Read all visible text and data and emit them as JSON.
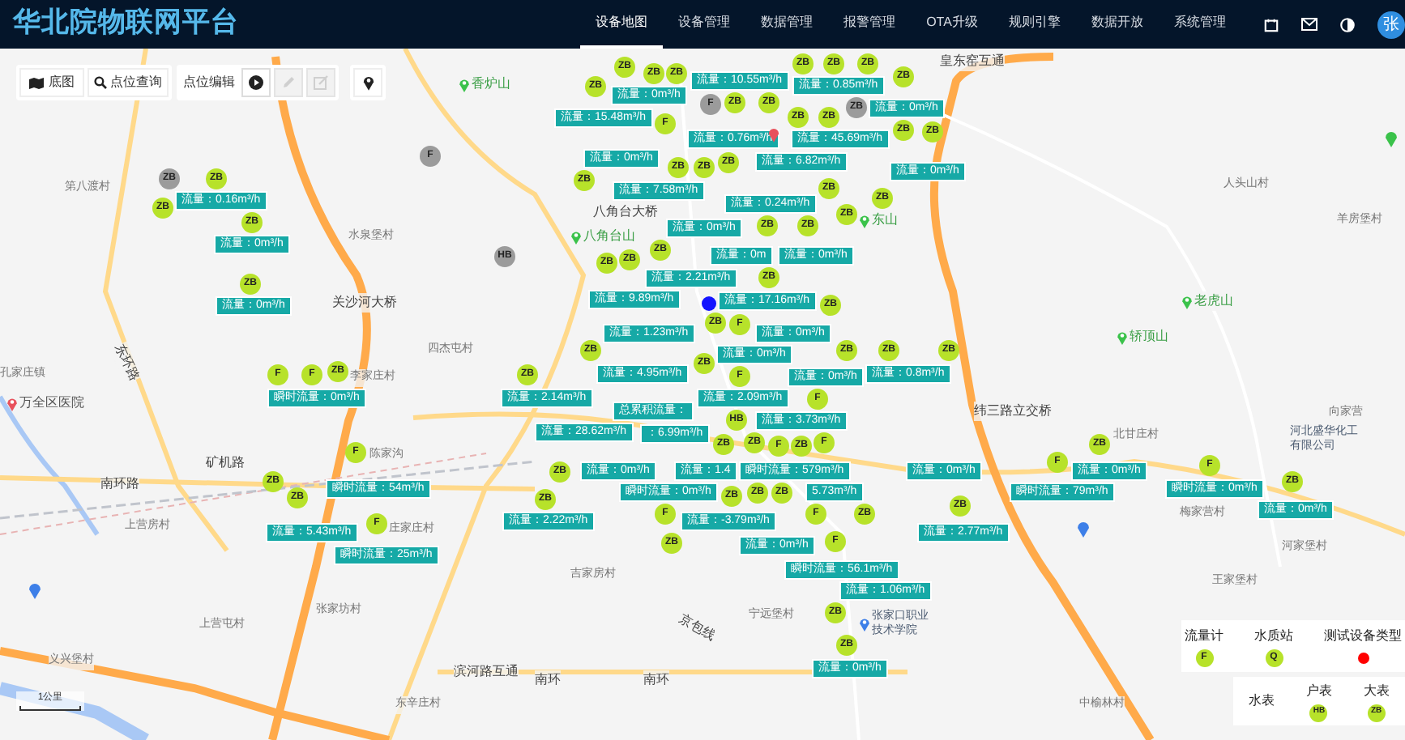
{
  "header": {
    "title": "华北院物联网平台",
    "nav": [
      {
        "label": "设备地图",
        "selected": true
      },
      {
        "label": "设备管理",
        "selected": false
      },
      {
        "label": "数据管理",
        "selected": false
      },
      {
        "label": "报警管理",
        "selected": false
      },
      {
        "label": "OTA升级",
        "selected": false
      },
      {
        "label": "规则引擎",
        "selected": false
      },
      {
        "label": "数据开放",
        "selected": false
      },
      {
        "label": "系统管理",
        "selected": false
      }
    ],
    "avatar": "张"
  },
  "toolbar": {
    "basemap": "底图",
    "search": "点位查询",
    "edit": "点位编辑",
    "tools": [
      {
        "kind": "play",
        "disabled": false
      },
      {
        "kind": "pencil",
        "disabled": true
      },
      {
        "kind": "edit",
        "disabled": true
      }
    ]
  },
  "map": {
    "places": [
      {
        "text": "皇东窑互通",
        "kind": "road"
      },
      {
        "text": "香炉山",
        "kind": "poi"
      },
      {
        "text": "人头山村",
        "kind": "village"
      },
      {
        "text": "第八渡村",
        "kind": "village"
      },
      {
        "text": "八角台大桥",
        "kind": "road"
      },
      {
        "text": "东山",
        "kind": "poi"
      },
      {
        "text": "羊房堡村",
        "kind": "village"
      },
      {
        "text": "八角台山",
        "kind": "poi"
      },
      {
        "text": "水泉堡村",
        "kind": "village"
      },
      {
        "text": "老虎山",
        "kind": "poi"
      },
      {
        "text": "关沙河大桥",
        "kind": "road"
      },
      {
        "text": "轿顶山",
        "kind": "poi"
      },
      {
        "text": "四杰屯村",
        "kind": "village"
      },
      {
        "text": "东环路",
        "kind": "road"
      },
      {
        "text": "孔家庄镇",
        "kind": "village"
      },
      {
        "text": "李家庄村",
        "kind": "village"
      },
      {
        "text": "万全区医院",
        "kind": "hospital"
      },
      {
        "text": "纬三路立交桥",
        "kind": "road"
      },
      {
        "text": "向家营",
        "kind": "village"
      },
      {
        "text": "北甘庄村",
        "kind": "village"
      },
      {
        "text": "河北盛华化工有限公司",
        "kind": "company"
      },
      {
        "text": "陈家沟",
        "kind": "village"
      },
      {
        "text": "矿机路",
        "kind": "road"
      },
      {
        "text": "南环路",
        "kind": "road"
      },
      {
        "text": "梅家营村",
        "kind": "village"
      },
      {
        "text": "上营房村",
        "kind": "village"
      },
      {
        "text": "庄家庄村",
        "kind": "village"
      },
      {
        "text": "河家堡村",
        "kind": "village"
      },
      {
        "text": "吉家房村",
        "kind": "village"
      },
      {
        "text": "王家堡村",
        "kind": "village"
      },
      {
        "text": "上营屯村",
        "kind": "village"
      },
      {
        "text": "张家坊村",
        "kind": "village"
      },
      {
        "text": "京包线",
        "kind": "road"
      },
      {
        "text": "宁远堡村",
        "kind": "village"
      },
      {
        "text": "张家口职业技术学院",
        "kind": "school"
      },
      {
        "text": "义兴堡村",
        "kind": "village"
      },
      {
        "text": "滨河路互通",
        "kind": "road"
      },
      {
        "text": "南环",
        "kind": "road"
      },
      {
        "text": "南环",
        "kind": "road"
      },
      {
        "text": "东辛庄村",
        "kind": "village"
      },
      {
        "text": "中榆林村",
        "kind": "village"
      }
    ],
    "markers": [
      {
        "label": "ZB",
        "online": true
      },
      {
        "label": "ZB",
        "online": true
      },
      {
        "label": "ZB",
        "online": true
      },
      {
        "label": "ZB",
        "online": true
      },
      {
        "label": "ZB",
        "online": true
      },
      {
        "label": "ZB",
        "online": true
      },
      {
        "label": "ZB",
        "online": true
      },
      {
        "label": "ZB",
        "online": true
      },
      {
        "label": "ZB",
        "online": true
      },
      {
        "label": "ZB",
        "online": true
      },
      {
        "label": "F",
        "online": false
      },
      {
        "label": "ZB",
        "online": false
      },
      {
        "label": "F",
        "online": true
      },
      {
        "label": "ZB",
        "online": true
      },
      {
        "label": "ZB",
        "online": true
      },
      {
        "label": "ZB",
        "online": true
      },
      {
        "label": "ZB",
        "online": true
      },
      {
        "label": "ZB",
        "online": true
      },
      {
        "label": "ZB",
        "online": true
      },
      {
        "label": "F",
        "online": false
      },
      {
        "label": "ZB",
        "online": true
      },
      {
        "label": "ZB",
        "online": true
      },
      {
        "label": "ZB",
        "online": true
      },
      {
        "label": "ZB",
        "online": false
      },
      {
        "label": "ZB",
        "online": true
      },
      {
        "label": "ZB",
        "online": true
      },
      {
        "label": "ZB",
        "online": true
      },
      {
        "label": "ZB",
        "online": true
      },
      {
        "label": "ZB",
        "online": true
      },
      {
        "label": "ZB",
        "online": true
      },
      {
        "label": "ZB",
        "online": true
      },
      {
        "label": "ZB",
        "online": true
      },
      {
        "label": "ZB",
        "online": true
      },
      {
        "label": "ZB",
        "online": true
      },
      {
        "label": "HB",
        "online": false
      },
      {
        "label": "ZB",
        "online": true
      },
      {
        "label": "ZB",
        "online": true
      },
      {
        "label": "ZB",
        "online": true
      },
      {
        "label": "F",
        "online": true
      },
      {
        "label": "ZB",
        "online": true
      },
      {
        "label": "ZB",
        "online": true
      },
      {
        "label": "ZB",
        "online": true
      },
      {
        "label": "F",
        "online": true
      },
      {
        "label": "ZB",
        "online": true
      },
      {
        "label": "ZB",
        "online": true
      },
      {
        "label": "ZB",
        "online": true
      },
      {
        "label": "ZB",
        "online": true
      },
      {
        "label": "F",
        "online": true
      },
      {
        "label": "F",
        "online": true
      },
      {
        "label": "ZB",
        "online": true
      },
      {
        "label": "HB",
        "online": true
      },
      {
        "label": "ZB",
        "online": true
      },
      {
        "label": "ZB",
        "online": true
      },
      {
        "label": "F",
        "online": true
      },
      {
        "label": "ZB",
        "online": true
      },
      {
        "label": "ZB",
        "online": true
      },
      {
        "label": "ZB",
        "online": true
      },
      {
        "label": "F",
        "online": true
      },
      {
        "label": "ZB",
        "online": true
      },
      {
        "label": "F",
        "online": true
      },
      {
        "label": "ZB",
        "online": true
      },
      {
        "label": "F",
        "online": true
      },
      {
        "label": "F",
        "online": true
      },
      {
        "label": "F",
        "online": true
      },
      {
        "label": "F",
        "online": true
      },
      {
        "label": "ZB",
        "online": true
      },
      {
        "label": "ZB",
        "online": true
      },
      {
        "label": "ZB",
        "online": true
      },
      {
        "label": "ZB",
        "online": true
      },
      {
        "label": "ZB",
        "online": true
      },
      {
        "label": "ZB",
        "online": true
      },
      {
        "label": "ZB",
        "online": true
      },
      {
        "label": "F",
        "online": true
      },
      {
        "label": "ZB",
        "online": true
      },
      {
        "label": "F",
        "online": true
      },
      {
        "label": "F",
        "online": true
      },
      {
        "label": "ZB",
        "online": true
      },
      {
        "label": "ZB",
        "online": true
      }
    ],
    "tags": [
      "流量：10.55m³/h",
      "流量：0.85m³/h",
      "流量：0m³/h",
      "流量：0m³/h",
      "流量：15.48m³/h",
      "流量：0.76m³/h",
      "流量：45.69m³/h",
      "流量：0m³/h",
      "流量：6.82m³/h",
      "流量：0m³/h",
      "流量：7.58m³/h",
      "流量：0.16m³/h",
      "流量：0.24m³/h",
      "流量：0m³/h",
      "流量：0m³/h",
      "流量：0m",
      "流量：0m³/h",
      "流量：2.21m³/h",
      "流量：9.89m³/h",
      "流量：17.16m³/h",
      "流量：0m³/h",
      "流量：1.23m³/h",
      "流量：0m³/h",
      "流量：0m³/h",
      "流量：4.95m³/h",
      "流量：0m³/h",
      "流量：0.8m³/h",
      "瞬时流量：0m³/h",
      "流量：2.14m³/h",
      "流量：2.09m³/h",
      "总累积流量：",
      "流量：3.73m³/h",
      "流量：28.62m³/h",
      "：6.99m³/h",
      "流量：0m³/h",
      "流量：1.4",
      "瞬时流量：579m³/h",
      "流量：0m³/h",
      "流量：0m³/h",
      "瞬时流量：54m³/h",
      "瞬时流量：0m³/h",
      "5.73m³/h",
      "瞬时流量：79m³/h",
      "瞬时流量：0m³/h",
      "流量：0m³/h",
      "流量：2.22m³/h",
      "流量：-3.79m³/h",
      "流量：5.43m³/h",
      "流量：2.77m³/h",
      "瞬时流量：25m³/h",
      "流量：0m³/h",
      "瞬时流量：56.1m³/h",
      "流量：1.06m³/h",
      "流量：0m³/h"
    ],
    "scale": "1公里"
  },
  "legend": {
    "items": [
      {
        "label": "流量计",
        "kind": "marker",
        "symbol": "F"
      },
      {
        "label": "水质站",
        "kind": "marker",
        "symbol": "Q"
      },
      {
        "label": "测试设备类型",
        "kind": "dot",
        "color": "#ff0000"
      }
    ],
    "water_meter": {
      "label": "水表",
      "items": [
        {
          "label": "户表",
          "symbol": "HB"
        },
        {
          "label": "大表",
          "symbol": "ZB"
        }
      ]
    }
  }
}
